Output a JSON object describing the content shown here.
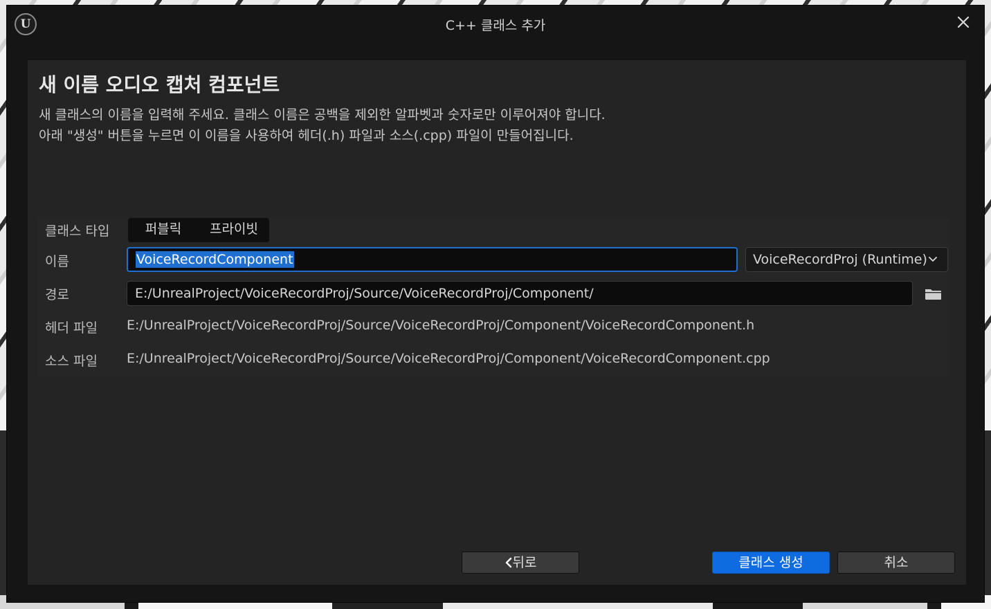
{
  "window": {
    "title": "C++ 클래스 추가",
    "logo_text": "U"
  },
  "header": {
    "title": "새 이름 오디오 캡처 컴포넌트",
    "description_line1": "새 클래스의 이름을 입력해 주세요. 클래스 이름은 공백을 제외한 알파벳과 숫자로만 이루어져야 합니다.",
    "description_line2": "아래 \"생성\" 버튼을 누르면 이 이름을 사용하여 헤더(.h) 파일과 소스(.cpp) 파일이 만들어집니다."
  },
  "form": {
    "class_type": {
      "label": "클래스 타입",
      "options": [
        "퍼블릭",
        "프라이빗"
      ]
    },
    "name": {
      "label": "이름",
      "value": "VoiceRecordComponent"
    },
    "module": {
      "selected": "VoiceRecordProj (Runtime)"
    },
    "path": {
      "label": "경로",
      "value": "E:/UnrealProject/VoiceRecordProj/Source/VoiceRecordProj/Component/"
    },
    "header_file": {
      "label": "헤더 파일",
      "value": "E:/UnrealProject/VoiceRecordProj/Source/VoiceRecordProj/Component/VoiceRecordComponent.h"
    },
    "source_file": {
      "label": "소스 파일",
      "value": "E:/UnrealProject/VoiceRecordProj/Source/VoiceRecordProj/Component/VoiceRecordComponent.cpp"
    }
  },
  "footer": {
    "back_label": "뒤로",
    "create_label": "클래스 생성",
    "cancel_label": "취소"
  },
  "icons": {
    "logo": "unreal-logo-icon",
    "close": "close-icon",
    "dropdown": "chevron-down-icon",
    "folder": "folder-icon",
    "back": "chevron-left-icon"
  },
  "colors": {
    "accent": "#0f6ce0",
    "selection": "#1f6fd1",
    "panel": "#242424",
    "window": "#151515"
  }
}
